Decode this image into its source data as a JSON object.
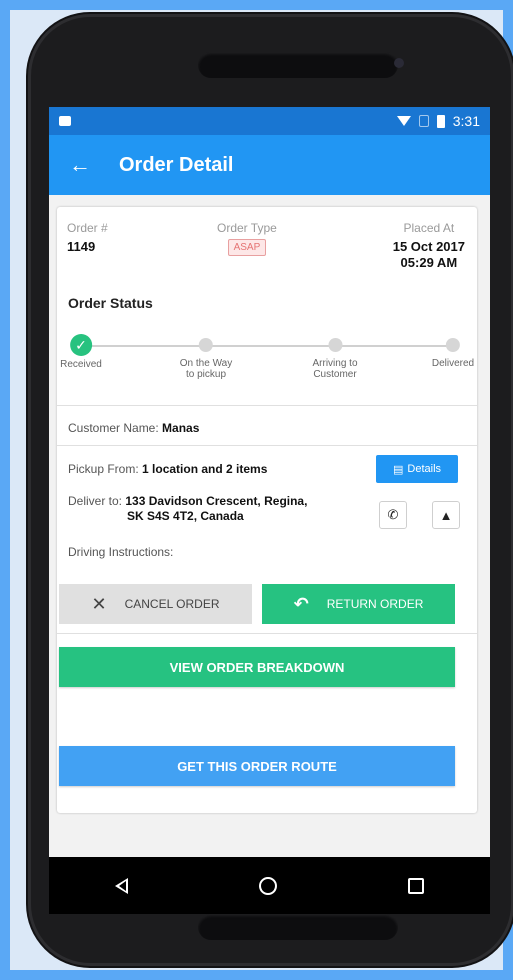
{
  "status_bar": {
    "time": "3:31"
  },
  "app_bar": {
    "title": "Order Detail"
  },
  "order": {
    "number_label": "Order #",
    "number_value": "1149",
    "type_label": "Order Type",
    "type_value": "ASAP",
    "placed_label": "Placed At",
    "placed_date": "15 Oct 2017",
    "placed_time": "05:29 AM"
  },
  "status": {
    "title": "Order Status",
    "steps": [
      {
        "label1": "Received",
        "label2": "",
        "done": true
      },
      {
        "label1": "On the Way",
        "label2": "to pickup",
        "done": false
      },
      {
        "label1": "Arriving to",
        "label2": "Customer",
        "done": false
      },
      {
        "label1": "Delivered",
        "label2": "",
        "done": false
      }
    ]
  },
  "customer": {
    "label": "Customer Name:",
    "value": "Manas"
  },
  "pickup": {
    "label": "Pickup From:",
    "value": "1 location and 2 items",
    "details_button": "Details"
  },
  "deliver": {
    "label": "Deliver to:",
    "line1": "133 Davidson Crescent, Regina,",
    "line2": "SK S4S 4T2, Canada"
  },
  "driving": {
    "label": "Driving Instructions:"
  },
  "actions": {
    "cancel_label": "CANCEL ORDER",
    "return_label": "RETURN ORDER"
  },
  "buttons": {
    "breakdown_label": "VIEW ORDER BREAKDOWN",
    "route_label": "GET THIS ORDER ROUTE"
  },
  "colors": {
    "appbar": "#2196f3",
    "statusbar": "#1976d2",
    "green": "#26c281",
    "blue": "#42a1f3"
  }
}
